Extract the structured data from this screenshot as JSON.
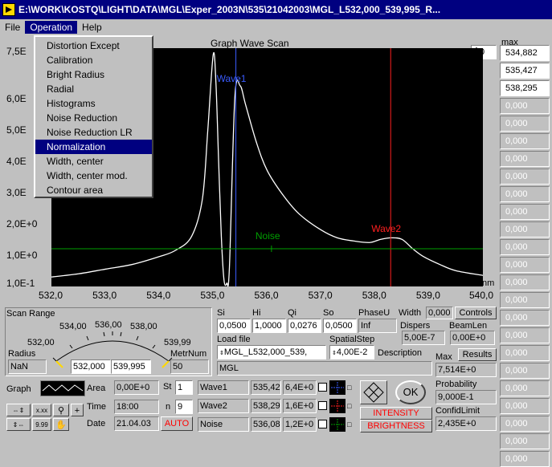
{
  "window": {
    "title": "E:\\WORK\\KOSTQ\\LIGHT\\DATA\\MGL\\Exper_2003N\\535\\21042003\\MGL_L532,000_539,995_R..."
  },
  "menu": {
    "file": "File",
    "operation": "Operation",
    "help": "Help"
  },
  "operation_menu": {
    "items": [
      "Distortion Except",
      "Calibration",
      "Bright Radius",
      "Radial",
      "Histograms",
      "Noise Reduction",
      "Noise Reduction LR",
      "Normalization",
      "Width, center",
      "Width, center mod.",
      "Contour area"
    ],
    "highlighted": "Normalization"
  },
  "graph": {
    "title": "Graph   Wave Scan",
    "spinner_value": "0",
    "x_unit": "nm",
    "cursors": {
      "wave1": "Wave1",
      "wave2": "Wave2",
      "noise": "Noise"
    },
    "colors": {
      "background": "#000000",
      "curve": "#ffffff",
      "wave1": "#3a5cff",
      "wave2": "#ff2020",
      "noise": "#00a000"
    }
  },
  "chart_data": {
    "type": "line",
    "title": "Graph   Wave Scan",
    "xlabel": "nm",
    "xlim": [
      532.0,
      540.0
    ],
    "ylim": [
      0.1,
      7.5
    ],
    "x_ticks": [
      "532,0",
      "533,0",
      "534,0",
      "535,0",
      "536,0",
      "537,0",
      "538,0",
      "539,0",
      "540,0"
    ],
    "x_tick_values": [
      532,
      533,
      534,
      535,
      536,
      537,
      538,
      539,
      540
    ],
    "y_ticks": [
      "7,5E",
      "6,0E",
      "5,0E",
      "4,0E",
      "3,0E",
      "2,0E+0",
      "1,0E+0",
      "1,0E-1"
    ],
    "y_tick_values": [
      7.5,
      6.0,
      5.0,
      4.0,
      3.0,
      2.0,
      1.0,
      0.1
    ],
    "series": [
      {
        "x": [
          532.0,
          532.5,
          533.0,
          533.5,
          534.0,
          534.3,
          534.6,
          534.8,
          534.9,
          535.0,
          535.05,
          535.1,
          535.15,
          535.2,
          535.25,
          535.3,
          535.4,
          535.5,
          535.6,
          535.8,
          536.0,
          536.3,
          536.6,
          537.0,
          537.3,
          537.6,
          537.9,
          538.1,
          538.3,
          538.5,
          538.7,
          538.9,
          539.2,
          539.5,
          540.0
        ],
        "y": [
          0.3,
          0.4,
          0.55,
          0.7,
          0.95,
          1.15,
          1.6,
          2.8,
          5.0,
          7.4,
          6.5,
          4.0,
          1.6,
          0.2,
          0.1,
          0.6,
          6.0,
          6.4,
          5.8,
          4.6,
          3.7,
          2.9,
          2.3,
          1.8,
          1.55,
          1.45,
          1.4,
          1.5,
          1.55,
          1.5,
          1.2,
          0.95,
          0.7,
          0.5,
          0.35
        ]
      }
    ],
    "cursors": [
      {
        "name": "Wave1",
        "x": 535.42
      },
      {
        "name": "Wave2",
        "x": 538.29
      },
      {
        "name": "Noise",
        "x": 536.08,
        "y": 1.2
      }
    ],
    "grid": false
  },
  "max_panel": {
    "label": "max",
    "values": [
      "534,882",
      "535,427",
      "538,295",
      "0,000",
      "0,000",
      "0,000",
      "0,000",
      "0,000",
      "0,000",
      "0,000",
      "0,000",
      "0,000",
      "0,000",
      "0,000",
      "0,000",
      "0,000",
      "0,000",
      "0,000",
      "0,000",
      "0,000",
      "0,000",
      "0,000",
      "0,000",
      "0,000"
    ]
  },
  "scan_range": {
    "label": "Scan Range",
    "ticks": [
      "532,00",
      "534,00",
      "536,00",
      "538,00",
      "539,99"
    ],
    "radius_label": "Radius",
    "radius_value": "NaN",
    "from": "532,000",
    "to": "539,995",
    "metr_label": "MetrNum",
    "metr_value": "50"
  },
  "params": {
    "si_label": "Si",
    "si": "0,0500",
    "hi_label": "Hi",
    "hi": "1,0000",
    "qi_label": "Qi",
    "qi": "0,0276",
    "so_label": "So",
    "so": "0,0500",
    "phase_label": "PhaseU",
    "phase": "Inf",
    "width_label": "Width",
    "width": "0,000",
    "controls_label": "Controls",
    "dispers_label": "Dispers",
    "dispers": "5,00E-7",
    "beamlen_label": "BeamLen",
    "beamlen": "0,00E+0",
    "loadfile_label": "Load file",
    "loadfile": "MGL_L532,000_539,",
    "spatial_label": "SpatialStep",
    "spatial": "4,00E-2",
    "description_label": "Description",
    "description": "MGL"
  },
  "results": {
    "max_label": "Max",
    "results_btn": "Results",
    "max_value": "7,514E+0",
    "probability_label": "Probability",
    "probability": "9,000E-1",
    "conf_label": "ConfidLimit",
    "conf": "2,435E+0"
  },
  "bottom": {
    "graph_label": "Graph",
    "area_label": "Area",
    "area": "0,00E+0",
    "time_label": "Time",
    "time": "18:00",
    "date_label": "Date",
    "date": "21.04.03",
    "st_label": "St",
    "st": "1",
    "n_label": "n",
    "n": "9",
    "auto_btn": "AUTO",
    "rows": [
      {
        "name": "Wave1",
        "pos": "535,42",
        "val": "6,4E+0"
      },
      {
        "name": "Wave2",
        "pos": "538,29",
        "val": "1,6E+0"
      },
      {
        "name": "Noise",
        "pos": "536,08",
        "val": "1,2E+0"
      }
    ],
    "ok_btn": "OK",
    "intensity_btn": "INTENSITY",
    "brightness_btn": "BRIGHTNESS",
    "tool_labels": {
      "xx": "x.xx",
      "x9": "9.99"
    }
  }
}
